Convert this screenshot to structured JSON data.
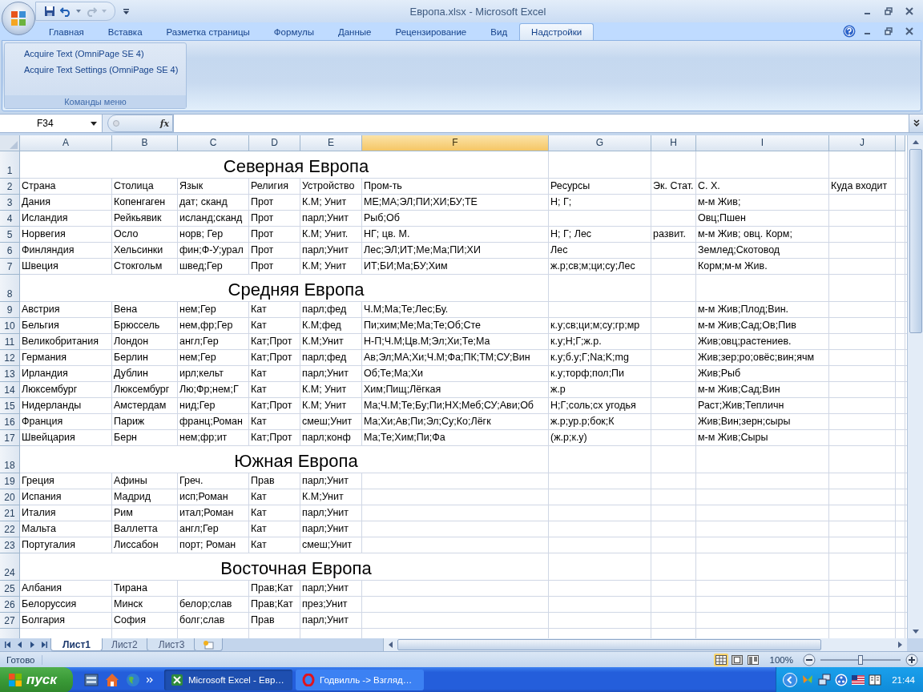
{
  "window": {
    "title": "Европа.xlsx - Microsoft Excel"
  },
  "ribbon": {
    "tabs": [
      {
        "label": "Главная",
        "selected": false
      },
      {
        "label": "Вставка",
        "selected": false
      },
      {
        "label": "Разметка страницы",
        "selected": false
      },
      {
        "label": "Формулы",
        "selected": false
      },
      {
        "label": "Данные",
        "selected": false
      },
      {
        "label": "Рецензирование",
        "selected": false
      },
      {
        "label": "Вид",
        "selected": false
      },
      {
        "label": "Надстройки",
        "selected": true
      }
    ],
    "groups": [
      {
        "label": "Команды меню",
        "items": [
          "Acquire Text (OmniPage SE 4)",
          "Acquire Text Settings (OmniPage SE 4)"
        ]
      }
    ]
  },
  "formula_bar": {
    "name_box": "F34",
    "function_label": "fx"
  },
  "sheet": {
    "columns": [
      {
        "label": "A",
        "selected": false
      },
      {
        "label": "B",
        "selected": false
      },
      {
        "label": "C",
        "selected": false
      },
      {
        "label": "D",
        "selected": false
      },
      {
        "label": "E",
        "selected": false
      },
      {
        "label": "F",
        "selected": true
      },
      {
        "label": "G",
        "selected": false
      },
      {
        "label": "H",
        "selected": false
      },
      {
        "label": "I",
        "selected": false
      },
      {
        "label": "J",
        "selected": false
      }
    ],
    "rows": [
      {
        "number": "1",
        "kind": "title",
        "text": "Северная Европа"
      },
      {
        "number": "2",
        "kind": "data",
        "cells": [
          "Страна",
          "Столица",
          "Язык",
          "Религия",
          "Устройство",
          "Пром-ть",
          "Ресурсы",
          "Эк. Стат.",
          "С. Х.",
          "Куда входит"
        ]
      },
      {
        "number": "3",
        "kind": "data",
        "cells": [
          "Дания",
          "Копенгаген",
          "дат; сканд",
          "Прот",
          "К.М; Унит",
          "МЕ;МА;ЭЛ;ПИ;ХИ;БУ;ТЕ",
          "Н; Г;",
          null,
          "м-м Жив;"
        ]
      },
      {
        "number": "4",
        "kind": "data",
        "cells": [
          "Исландия",
          "Рейкьявик",
          "исланд;сканд",
          "Прот",
          "парл;Унит",
          "Рыб;Об",
          null,
          null,
          "Овц;Пшен"
        ]
      },
      {
        "number": "5",
        "kind": "data",
        "cells": [
          "Норвегия",
          "Осло",
          "норв; Гер",
          "Прот",
          "К.М; Унит.",
          "НГ; цв. М.",
          "Н; Г; Лес",
          "развит.",
          "м-м Жив; овц. Корм;"
        ]
      },
      {
        "number": "6",
        "kind": "data",
        "cells": [
          "Финляндия",
          "Хельсинки",
          "фин;Ф-У;урал",
          "Прот",
          "парл;Унит",
          "Лес;ЭЛ;ИТ;Ме;Ма;ПИ;ХИ",
          "Лес",
          null,
          "Землед;Скотовод"
        ]
      },
      {
        "number": "7",
        "kind": "data",
        "cells": [
          "Швеция",
          "Стокгольм",
          "швед;Гер",
          "Прот",
          "К.М; Унит",
          "ИТ;БИ;Ма;БУ;Хим",
          "ж.р;св;м;ци;су;Лес",
          null,
          "Корм;м-м Жив."
        ]
      },
      {
        "number": "8",
        "kind": "title",
        "text": "Средняя Европа"
      },
      {
        "number": "9",
        "kind": "data",
        "cells": [
          "Австрия",
          "Вена",
          "нем;Гер",
          "Кат",
          "парл;фед",
          "Ч.М;Ма;Те;Лес;Бу.",
          null,
          null,
          "м-м Жив;Плод;Вин."
        ]
      },
      {
        "number": "10",
        "kind": "data",
        "cells": [
          "Бельгия",
          "Брюссель",
          "нем,фр;Гер",
          "Кат",
          "К.М;фед",
          "Пи;хим;Ме;Ма;Те;Об;Сте",
          "к.у;св;ци;м;су;гр;мр",
          null,
          "м-м Жив;Сад;Ов;Пив"
        ]
      },
      {
        "number": "11",
        "kind": "data",
        "cells": [
          "Великобритания",
          "Лондон",
          "англ;Гер",
          "Кат;Прот",
          "К.М;Унит",
          "Н-П;Ч.М;Цв.М;Эл;Хи;Те;Ма",
          "к.у;Н;Г;ж.р.",
          null,
          "Жив;овц;растениев."
        ]
      },
      {
        "number": "12",
        "kind": "data",
        "cells": [
          "Германия",
          "Берлин",
          "нем;Гер",
          "Кат;Прот",
          "парл;фед",
          "Ав;Эл;МА;Хи;Ч.М;Фа;ПК;ТМ;СУ;Вин",
          "к.у;б.у;Г;Na;K;mg",
          null,
          "Жив;зер;ро;овёс;вин;ячм"
        ]
      },
      {
        "number": "13",
        "kind": "data",
        "cells": [
          "Ирландия",
          "Дублин",
          "ирл;кельт",
          "Кат",
          "парл;Унит",
          "Об;Те;Ма;Хи",
          "к.у;торф;пол;Пи",
          null,
          "Жив;Рыб"
        ]
      },
      {
        "number": "14",
        "kind": "data",
        "cells": [
          "Люксембург",
          "Люксембург",
          "Лю;Фр;нем;Г",
          "Кат",
          "К.М; Унит",
          "Хим;Пищ;Лёгкая",
          "ж.р",
          null,
          "м-м Жив;Сад;Вин"
        ]
      },
      {
        "number": "15",
        "kind": "data",
        "cells": [
          "Нидерланды",
          "Амстердам",
          "нид;Гер",
          "Кат;Прот",
          "К.М; Унит",
          "Ма;Ч.М;Те;Бу;Пи;НХ;Меб;СУ;Ави;Об",
          "Н;Г;соль;сх угодья",
          null,
          "Раст;Жив;Тепличн"
        ]
      },
      {
        "number": "16",
        "kind": "data",
        "cells": [
          "Франция",
          "Париж",
          "франц;Роман",
          "Кат",
          "смеш;Унит",
          "Ма;Хи;Ав;Пи;Эл;Су;Ко;Лёгк",
          "ж.р;ур.р;бок;К",
          null,
          "Жив;Вин;зерн;сыры"
        ]
      },
      {
        "number": "17",
        "kind": "data",
        "cells": [
          "Швейцария",
          "Берн",
          "нем;фр;ит",
          "Кат;Прот",
          "парл;конф",
          "Ма;Те;Хим;Пи;Фа",
          "(ж.р;к.у)",
          null,
          "м-м Жив;Сыры"
        ]
      },
      {
        "number": "18",
        "kind": "title",
        "text": "Южная Европа"
      },
      {
        "number": "19",
        "kind": "data",
        "cells": [
          "Греция",
          "Афины",
          "Греч.",
          "Прав",
          "парл;Унит"
        ]
      },
      {
        "number": "20",
        "kind": "data",
        "cells": [
          "Испания",
          "Мадрид",
          "исп;Роман",
          "Кат",
          "К.М;Унит"
        ]
      },
      {
        "number": "21",
        "kind": "data",
        "cells": [
          "Италия",
          "Рим",
          "итал;Роман",
          "Кат",
          "парл;Унит"
        ]
      },
      {
        "number": "22",
        "kind": "data",
        "cells": [
          "Мальта",
          "Валлетта",
          "англ;Гер",
          "Кат",
          "парл;Унит"
        ]
      },
      {
        "number": "23",
        "kind": "data",
        "cells": [
          "Португалия",
          "Лиссабон",
          "порт; Роман",
          "Кат",
          "смеш;Унит"
        ]
      },
      {
        "number": "24",
        "kind": "title",
        "text": "Восточная Европа"
      },
      {
        "number": "25",
        "kind": "data",
        "cells": [
          "Албания",
          "Тирана",
          null,
          "Прав;Кат",
          "парл;Унит"
        ]
      },
      {
        "number": "26",
        "kind": "data",
        "cells": [
          "Белоруссия",
          "Минск",
          "белор;слав",
          "Прав;Кат",
          "през;Унит"
        ]
      },
      {
        "number": "27",
        "kind": "data",
        "cells": [
          "Болгария",
          "София",
          "болг;слав",
          "Прав",
          "парл;Унит"
        ]
      }
    ]
  },
  "sheet_tabs": [
    {
      "label": "Лист1",
      "selected": true
    },
    {
      "label": "Лист2",
      "selected": false
    },
    {
      "label": "Лист3",
      "selected": false
    }
  ],
  "status_bar": {
    "status": "Готово",
    "views": [
      {
        "kind": "normal",
        "selected": true
      },
      {
        "kind": "page-layout",
        "selected": false
      },
      {
        "kind": "page-break",
        "selected": false
      }
    ],
    "zoom": "100%",
    "zoom_slider": {
      "level": 0.5
    }
  },
  "taskbar": {
    "start": "пуск",
    "tasks": [
      {
        "kind": "excel",
        "label": "Microsoft Excel - Евр…",
        "selected": true
      },
      {
        "kind": "opera",
        "label": "Годвилль -> Взгляд…",
        "selected": false
      }
    ],
    "clock": "21:44"
  }
}
